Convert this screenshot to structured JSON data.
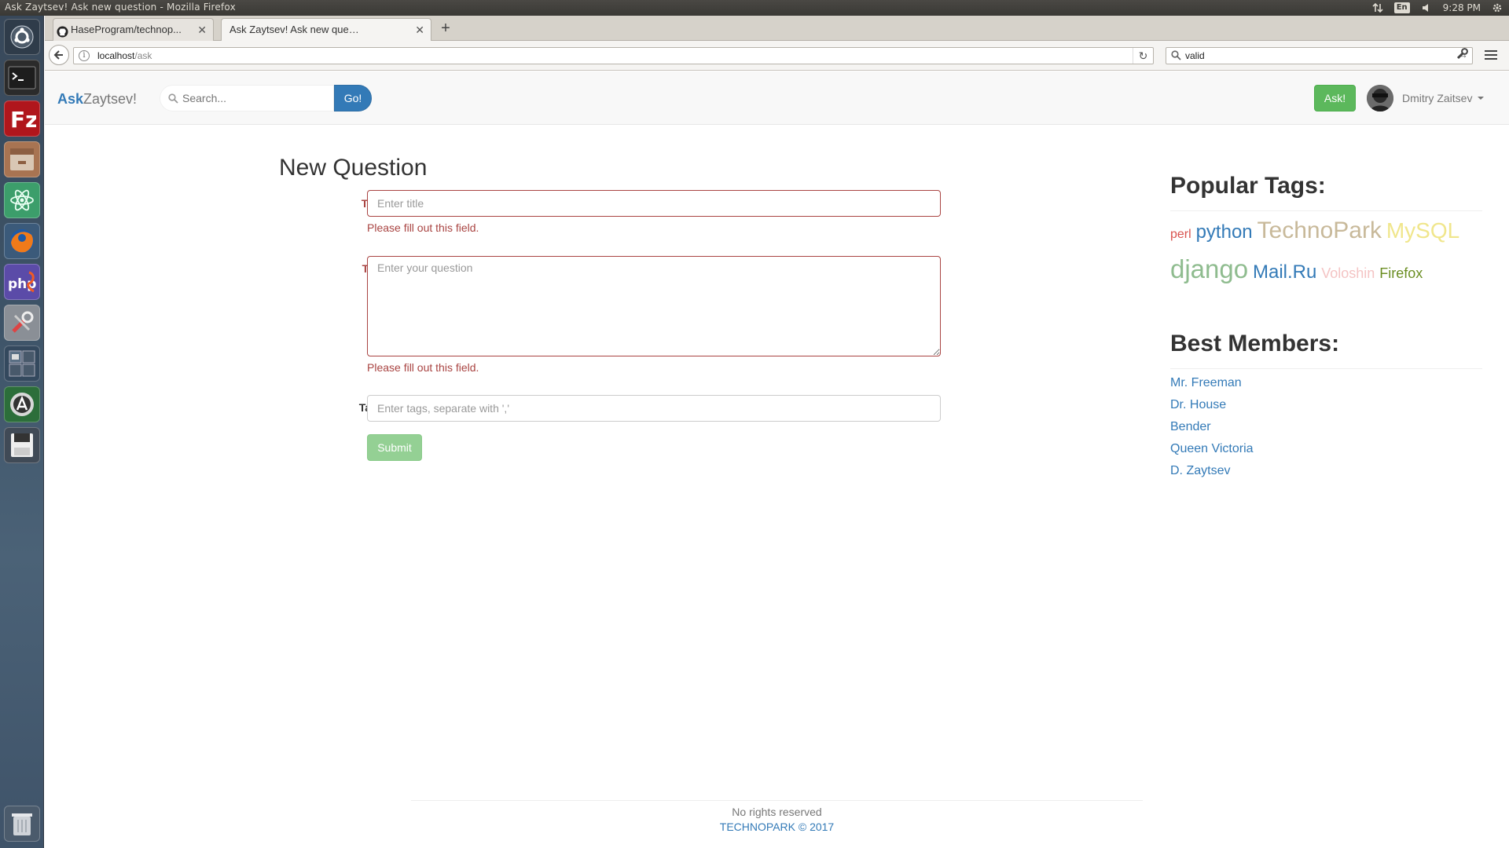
{
  "system": {
    "window_title": "Ask Zaytsev! Ask new question - Mozilla Firefox",
    "keyboard_layout": "En",
    "clock": "9:28 PM"
  },
  "launcher": {
    "items": [
      "ubuntu-dash-icon",
      "terminal-icon",
      "filezilla-icon",
      "file-manager-icon",
      "atom-icon",
      "firefox-icon",
      "phpstorm-icon",
      "system-settings-icon",
      "workspace-switcher-icon",
      "software-updater-icon",
      "drive-icon",
      "trash-icon"
    ]
  },
  "browser": {
    "tabs": [
      {
        "label": "HaseProgram/technop...",
        "icon": "github-icon",
        "active": false
      },
      {
        "label": "Ask Zaytsev! Ask new quest...",
        "icon": "",
        "active": true
      }
    ],
    "url_host": "localhost",
    "url_path": "/ask",
    "search_value": "valid"
  },
  "site": {
    "brand_bold": "Ask",
    "brand_rest": "Zaytsev!",
    "search_placeholder": "Search...",
    "go_label": "Go!",
    "ask_label": "Ask!",
    "user_name": "Dmitry Zaitsev"
  },
  "form": {
    "title": "New Question",
    "title_label": "Title:",
    "title_placeholder": "Enter title",
    "title_error": "Please fill out this field.",
    "text_label": "Text:",
    "text_placeholder": "Enter your question",
    "text_error": "Please fill out this field.",
    "tags_label": "Tags:",
    "tags_placeholder": "Enter tags, separate with ','",
    "submit_label": "Submit"
  },
  "sidebar": {
    "tags_title": "Popular Tags:",
    "tags": [
      {
        "name": "perl",
        "color": "#d9534f"
      },
      {
        "name": "python",
        "color": "#337ab7"
      },
      {
        "name": "TechnoPark",
        "color": "#c8b99a"
      },
      {
        "name": "MySQL",
        "color": "#f0e68c"
      },
      {
        "name": "django",
        "color": "#8fbc8f"
      },
      {
        "name": "Mail.Ru",
        "color": "#337ab7"
      },
      {
        "name": "Voloshin",
        "color": "#f4c4c4"
      },
      {
        "name": "Firefox",
        "color": "#6b8e23"
      }
    ],
    "members_title": "Best Members:",
    "members": [
      "Mr. Freeman",
      "Dr. House",
      "Bender",
      "Queen Victoria",
      "D. Zaytsev"
    ]
  },
  "footer": {
    "line1": "No rights reserved",
    "line2": "TECHNOPARK ©  2017"
  }
}
